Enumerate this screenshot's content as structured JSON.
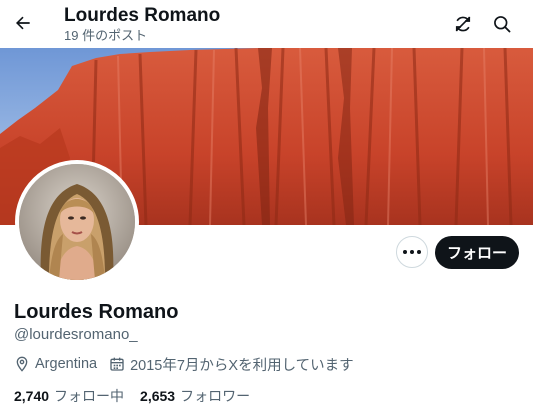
{
  "header": {
    "name": "Lourdes Romano",
    "post_count": "19 件のポスト"
  },
  "profile": {
    "display_name": "Lourdes Romano",
    "handle": "@lourdesromano_",
    "location": "Argentina",
    "joined": "2015年7月からXを利用しています"
  },
  "actions": {
    "follow_label": "フォロー"
  },
  "stats": {
    "following_count": "2,740",
    "following_label": "フォロー中",
    "followers_count": "2,653",
    "followers_label": "フォロワー"
  },
  "icons": {
    "back": "arrow-left-icon",
    "refresh": "refresh-icon",
    "search": "search-icon",
    "more": "more-horizontal-icon",
    "location": "location-pin-icon",
    "calendar": "calendar-icon"
  },
  "colors": {
    "text_primary": "#0f1419",
    "text_secondary": "#536471",
    "follow_button_bg": "#0f1419",
    "follow_button_text": "#ffffff",
    "banner_rock": "#c8432a",
    "banner_sky": "#8fb3e0"
  }
}
